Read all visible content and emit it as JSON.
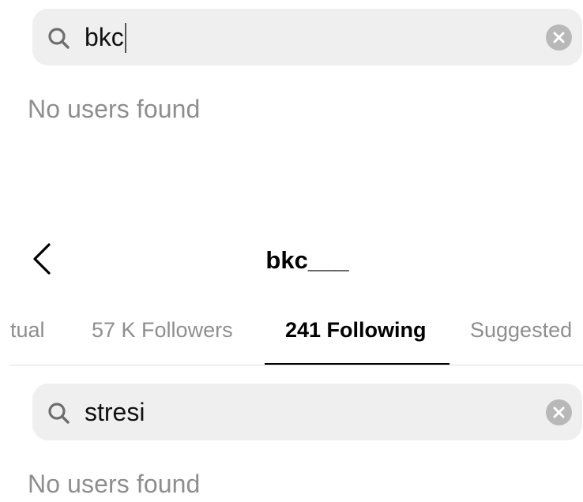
{
  "top_search": {
    "query": "bkc",
    "results_message": "No users found"
  },
  "header": {
    "title": "bkc___"
  },
  "tabs": [
    {
      "label": "tual",
      "active": false
    },
    {
      "label": "57 K Followers",
      "active": false
    },
    {
      "label": "241 Following",
      "active": true
    },
    {
      "label": "Suggested",
      "active": false
    }
  ],
  "bottom_search": {
    "query": "stresi",
    "results_message": "No users found"
  },
  "icons": {
    "search": "search-icon",
    "clear": "clear-icon",
    "back": "chevron-left-icon"
  },
  "colors": {
    "search_bg": "#efefef",
    "muted_text": "#8e8e8e",
    "clear_bg": "#b8b8b8"
  }
}
